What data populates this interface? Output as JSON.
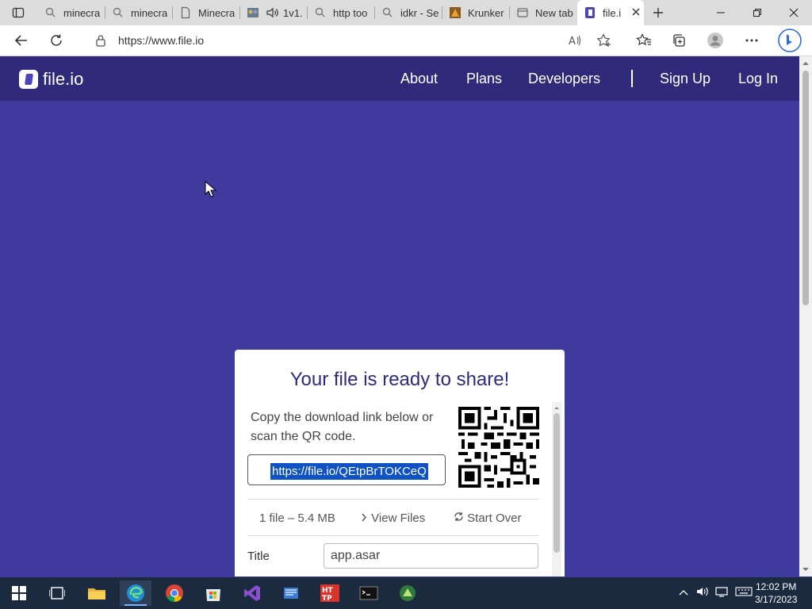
{
  "browser": {
    "tabs": [
      {
        "title": "minecra",
        "icon": "search-icon"
      },
      {
        "title": "minecra",
        "icon": "search-icon"
      },
      {
        "title": "Minecra",
        "icon": "document-icon"
      },
      {
        "title": "1v1.",
        "icon": "game-favicon"
      },
      {
        "title": "http too",
        "icon": "search-icon"
      },
      {
        "title": "idkr - Se",
        "icon": "search-icon"
      },
      {
        "title": "Krunker",
        "icon": "krunker-favicon"
      },
      {
        "title": "New tab",
        "icon": "newtab-icon"
      },
      {
        "title": "file.i",
        "icon": "fileio-favicon"
      }
    ],
    "url": "https://www.file.io"
  },
  "site": {
    "logo_text": "file.io",
    "nav": {
      "about": "About",
      "plans": "Plans",
      "developers": "Developers",
      "signup": "Sign Up",
      "login": "Log In"
    }
  },
  "card": {
    "title": "Your file is ready to share!",
    "description": "Copy the download link below or scan the QR code.",
    "link": "https://file.io/QEtpBrTOKCeQ",
    "file_info": "1 file – 5.4 MB",
    "view_files": "View Files",
    "start_over": "Start Over",
    "title_label": "Title",
    "title_value": "app.asar"
  },
  "taskbar": {
    "time": "12:02 PM",
    "date": "3/17/2023"
  },
  "colors": {
    "page_bg": "#3f3a9e",
    "header_bg": "#2f2b7a",
    "accent": "#2f2b7a"
  }
}
